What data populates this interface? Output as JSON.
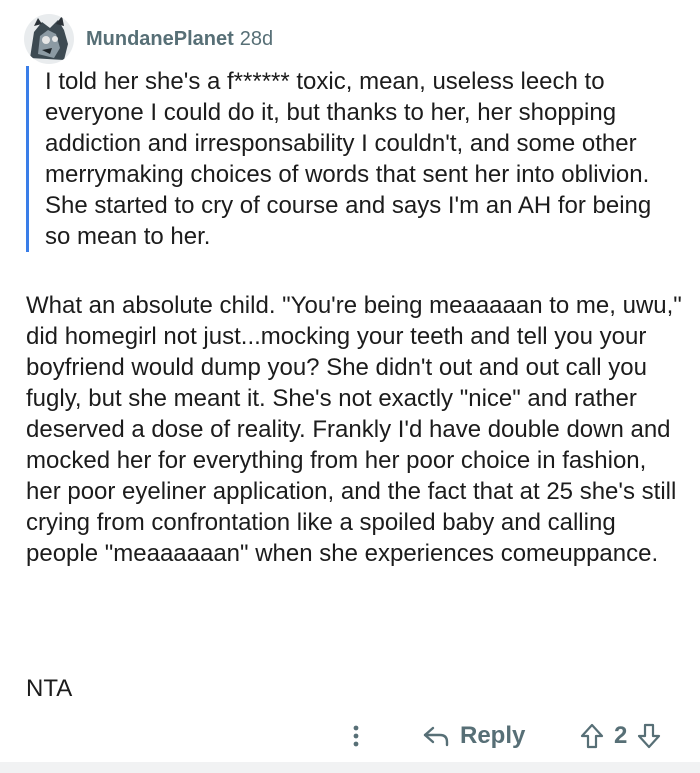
{
  "comment": {
    "username": "MundanePlanet",
    "age": "28d",
    "quote": "I told her she's a f****** toxic, mean, useless leech to everyone I could do it, but thanks to her, her shopping addiction and irresponsability I couldn't, and some other merrymaking choices of words that sent her into oblivion. She started to cry of course and says I'm an AH for being so mean to her.",
    "paragraphs": [
      "What an absolute child. \"You're being meaaaaan to me, uwu,\" did homegirl not just...mocking your teeth and tell you your boyfriend would dump you? She didn't out and out call you fugly, but she meant it. She's not exactly \"nice\" and rather deserved a dose of reality. Frankly I'd have double down and mocked her for everything from her poor choice in fashion, her poor eyeliner application, and the fact that at 25 she's still crying from confrontation like a spoiled baby and calling people \"meaaaaaan\" when she experiences comeuppance.",
      "NTA"
    ]
  },
  "actions": {
    "more_icon": "more-vertical-icon",
    "reply_icon": "reply-arrow-icon",
    "reply_label": "Reply",
    "upvote_icon": "upvote-arrow-icon",
    "vote_count": "2",
    "downvote_icon": "downvote-arrow-icon"
  },
  "colors": {
    "meta_gray": "#576f76",
    "quote_bar": "#3a7ee8",
    "text": "#1c1c1c",
    "background": "#f1f2f3"
  }
}
